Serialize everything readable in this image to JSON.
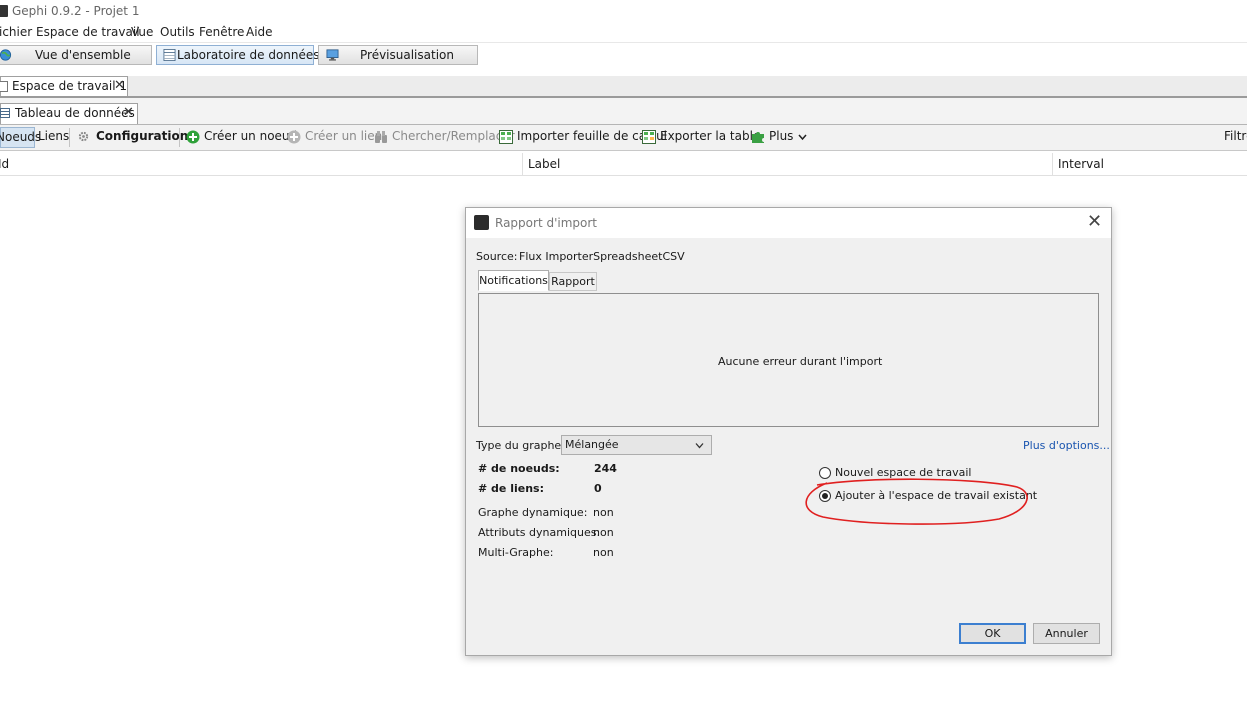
{
  "window": {
    "title": "Gephi 0.9.2 - Projet 1"
  },
  "menu": [
    "ichier",
    "Espace de travail",
    "Vue",
    "Outils",
    "Fenêtre",
    "Aide"
  ],
  "perspectives": {
    "overview": "Vue d'ensemble",
    "data_lab": "Laboratoire de données",
    "preview": "Prévisualisation"
  },
  "workspace_tab": {
    "label": "Espace de travail 1",
    "close": "✕"
  },
  "data_table_tab": {
    "label": "Tableau de données",
    "close": "✕"
  },
  "toolbar": {
    "nodes": "Noeuds",
    "edges": "Liens",
    "configuration": "Configuration",
    "create_node": "Créer un noeud",
    "create_edge": "Créer un lien",
    "search_replace": "Chercher/Remplacer",
    "import_spreadsheet": "Importer feuille de calcul",
    "export_table": "Exporter la table",
    "more": "Plus",
    "filter": "Filtre"
  },
  "table": {
    "columns": [
      "Id",
      "Label",
      "Interval"
    ]
  },
  "dialog": {
    "title": "Rapport d'import",
    "close": "✕",
    "source_label": "Source:",
    "source_value": "Flux ImporterSpreadsheetCSV",
    "tabs": [
      "Notifications",
      "Rapport"
    ],
    "notification_message": "Aucune erreur durant l'import",
    "graph_type_label": "Type du graphe:",
    "graph_type_value": "Mélangée",
    "more_options": "Plus d'options...",
    "stats": {
      "nodes_label": "# de noeuds:",
      "nodes_value": "244",
      "edges_label": "# de liens:",
      "edges_value": "0",
      "dyn_graph_label": "Graphe dynamique:",
      "dyn_graph_value": "non",
      "dyn_attr_label": "Attributs dynamiques:",
      "dyn_attr_value": "non",
      "multi_label": "Multi-Graphe:",
      "multi_value": "non"
    },
    "options": {
      "new_workspace": "Nouvel espace de travail",
      "append_workspace": "Ajouter à l'espace de travail existant",
      "selected": "append_workspace"
    },
    "ok": "OK",
    "cancel": "Annuler"
  },
  "colors": {
    "accent": "#3c7fd0",
    "annotation": "#e02020",
    "link": "#1a55b0"
  }
}
